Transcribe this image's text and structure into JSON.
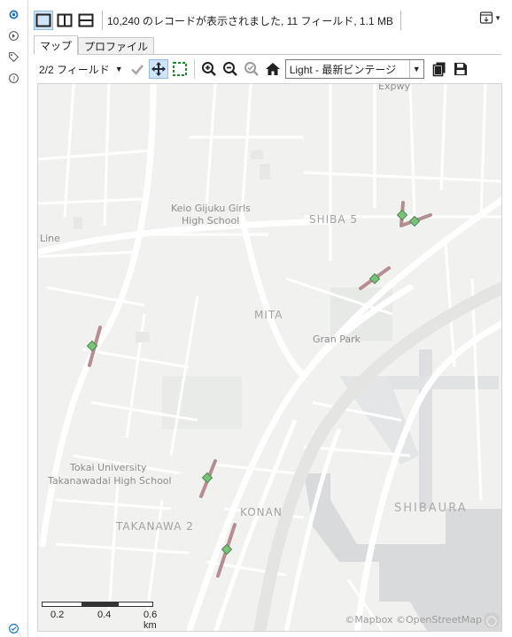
{
  "header": {
    "record_info": "10,240 のレコードが表示されました, 11 フィールド, 1.1 MB",
    "layout_buttons": [
      "single-view",
      "split-vertical",
      "split-horizontal"
    ]
  },
  "tabs": [
    {
      "label": "マップ",
      "active": true
    },
    {
      "label": "プロファイル",
      "active": false
    }
  ],
  "toolbar": {
    "field_select": "2/2 フィールド",
    "basemap": "Light - 最新ビンテージ"
  },
  "map": {
    "labels": {
      "school1_line1": "Keio Gijuku Girls",
      "school1_line2": "High School",
      "shiba5": "SHIBA 5",
      "line": "Line",
      "mita": "MITA",
      "gran_park": "Gran Park",
      "school2_line1": "Tokai University",
      "school2_line2": "Takanawadai High School",
      "konan": "KONAN",
      "takanawa2": "TAKANAWA 2",
      "shibaura": "SHIBAURA",
      "expwy": "Expwy"
    },
    "scale": {
      "t1": "0.2",
      "t2": "0.4",
      "t3": "0.6 km"
    },
    "attribution": "©Mapbox ©OpenStreetMap",
    "colors": {
      "marker": "#79c27a",
      "segment": "#b58e93",
      "water": "#d8dadb",
      "road": "#ffffff",
      "park": "#e9ece8"
    }
  },
  "icons": [
    "settings-icon",
    "gear-icon",
    "tag-icon",
    "help-icon",
    "check-circle-icon"
  ]
}
